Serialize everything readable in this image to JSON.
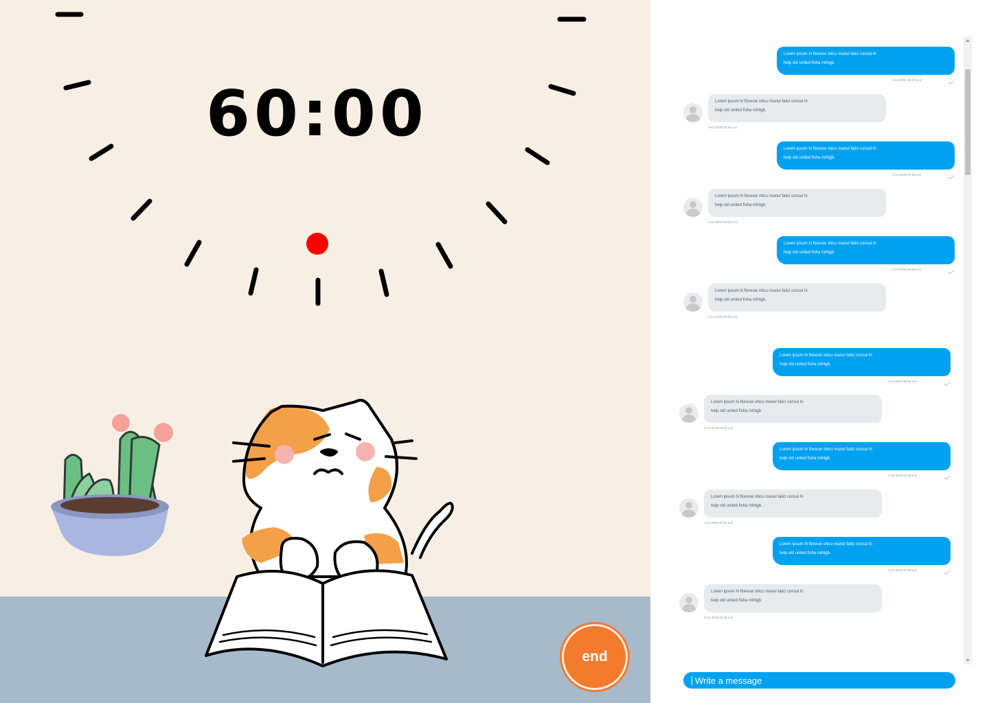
{
  "timer": {
    "display": "60:00"
  },
  "controls": {
    "end_label": "end"
  },
  "chat": {
    "messages": [
      {
        "dir": "out",
        "line1": "Lorem ipsum hi floreuw shicu manul falici consul hi",
        "line2": "help old united fisha mihtgb.",
        "time": "3 oct 2019 09:20 a.m"
      },
      {
        "dir": "in",
        "line1": "Lorem ipsum hi floreuw shicu manul falici consul hi",
        "line2": "help old united fisha mihtgb.",
        "time": "3 oct 2019 10:24 a.m"
      },
      {
        "dir": "out",
        "line1": "Lorem ipsum hi floreuw shicu manul falici consul hi",
        "line2": "help old united fisha mihtgb.",
        "time": "3 oct 2019 10:28 a.m"
      },
      {
        "dir": "in",
        "line1": "Lorem ipsum hi floreuw shicu manul falici consul hi",
        "line2": "help old united fisha mihtgb.",
        "time": "3 oct 2019 10:32 a.m"
      },
      {
        "dir": "out",
        "line1": "Lorem ipsum hi floreuw shicu manul falici consul hi",
        "line2": "help old united fisha mihtgb.",
        "time": "3 oct 2019 10:35 a.m"
      },
      {
        "dir": "in",
        "line1": "Lorem ipsum hi floreuw shicu manul falici consul hi",
        "line2": "help old united fisha mihtgb.",
        "time": "3 oct 2019 10:45 a.m"
      },
      {
        "dir": "out",
        "line1": "Lorem ipsum hi floreuw shicu manul falici consul hi",
        "line2": "help old united fisha mihtgb.",
        "time": "3 oct 2019 09:20 a.m"
      },
      {
        "dir": "in",
        "line1": "Lorem ipsum hi floreuw shicu manul falici consul hi",
        "line2": "help old united fisha mihtgb.",
        "time": "3 oct 2019 10:24 a.m"
      },
      {
        "dir": "out",
        "line1": "Lorem ipsum hi floreuw shicu manul falici consul hi",
        "line2": "help old united fisha mihtgb.",
        "time": "3 oct 2019 10:28 a.m"
      },
      {
        "dir": "in",
        "line1": "Lorem ipsum hi floreuw shicu manul falici consul hi",
        "line2": "help old united fisha mihtgb.",
        "time": "3 oct 2019 10:32 a.m"
      },
      {
        "dir": "out",
        "line1": "Lorem ipsum hi floreuw shicu manul falici consul hi",
        "line2": "help old united fisha mihtgb.",
        "time": "3 oct 2019 10:35 a.m"
      },
      {
        "dir": "in",
        "line1": "Lorem ipsum hi floreuw shicu manul falici consul hi",
        "line2": "help old united fisha mihtgb.",
        "time": "3 oct 2019 10:45 a.m"
      }
    ],
    "input_placeholder": "Write a message"
  },
  "colors": {
    "background": "#f8efe4",
    "floor": "#a6bacb",
    "accent_orange": "#f47a2c",
    "bubble_out": "#00a2f0",
    "bubble_in": "#e7ebee",
    "dial_indicator": "#ff0000"
  },
  "icons": {
    "avatar": "user-avatar-icon",
    "read_receipt": "check-icon",
    "indicator": "red-dot-icon"
  }
}
